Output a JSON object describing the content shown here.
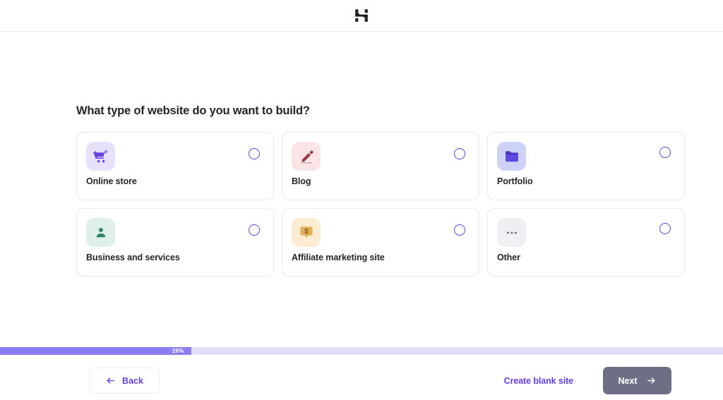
{
  "header": {
    "logo_icon": "hostinger-h-logo",
    "logo_color": "#1d1e20"
  },
  "main": {
    "title": "What type of website do you want to build?",
    "options": [
      {
        "label": "Online store",
        "icon": "shopping-cart-icon",
        "icon_bg": "#e8e1fb",
        "icon_color": "#6a42e0",
        "selected": false
      },
      {
        "label": "Blog",
        "icon": "pencil-icon",
        "icon_bg": "#fae4e5",
        "icon_color": "#8f3b4a",
        "selected": false
      },
      {
        "label": "Portfolio",
        "icon": "folder-icon",
        "icon_bg": "#ccd2f8",
        "icon_color": "#5b4ae0",
        "selected": false
      },
      {
        "label": "Business and services",
        "icon": "person-icon",
        "icon_bg": "#dff0e9",
        "icon_color": "#2e8467",
        "selected": false
      },
      {
        "label": "Affiliate marketing site",
        "icon": "dollar-speech-bubble-icon",
        "icon_bg": "#fcecd1",
        "icon_color": "#e2ae58",
        "selected": false
      },
      {
        "label": "Other",
        "icon": "ellipsis-icon",
        "icon_bg": "#eff0f3",
        "icon_color": "#6d7084",
        "selected": false
      }
    ]
  },
  "progress": {
    "percent_label": "26%",
    "percent_value": 26,
    "fill_color": "#8b7ef0",
    "track_color": "#dfe0f7"
  },
  "footer": {
    "back_label": "Back",
    "back_icon": "arrow-left-icon",
    "create_blank_label": "Create blank site",
    "next_label": "Next",
    "next_icon": "arrow-right-icon",
    "accent_color": "#673de6",
    "next_bg": "#6d7084"
  }
}
